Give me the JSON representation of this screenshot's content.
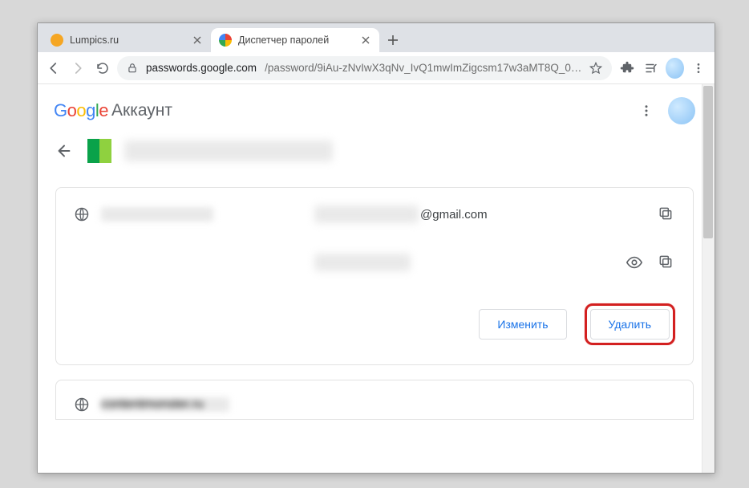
{
  "window": {
    "tabs": [
      {
        "title": "Lumpics.ru",
        "favicon_color": "#f5a623",
        "active": false
      },
      {
        "title": "Диспетчер паролей",
        "favicon_type": "google",
        "active": true
      }
    ]
  },
  "addressbar": {
    "host": "passwords.google.com",
    "path": "/password/9iAu-zNvIwX3qNv_IvQ1mwImZigcsm17w3aMT8Q_0…"
  },
  "header": {
    "logo_letters": [
      "G",
      "o",
      "o",
      "g",
      "l",
      "e"
    ],
    "account_label": "Аккаунт"
  },
  "detail": {
    "site_name_blurred": true,
    "username_suffix": "@gmail.com",
    "password_masked": true,
    "buttons": {
      "edit": "Изменить",
      "delete": "Удалить"
    }
  },
  "next_item": {
    "site": "contentmonster.ru"
  }
}
